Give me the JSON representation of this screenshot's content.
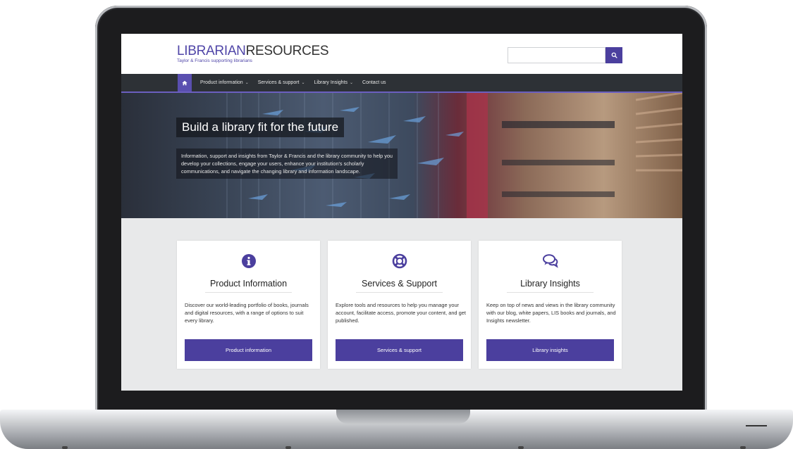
{
  "logo": {
    "part1": "LIBRARIAN",
    "part2": "RESOURCES",
    "tagline": "Taylor & Francis supporting librarians"
  },
  "search": {
    "placeholder": "",
    "icon": "search-icon"
  },
  "nav": {
    "home_icon": "home-icon",
    "items": [
      {
        "label": "Product information",
        "has_dropdown": true
      },
      {
        "label": "Services & support",
        "has_dropdown": true
      },
      {
        "label": "Library Insights",
        "has_dropdown": true
      },
      {
        "label": "Contact us",
        "has_dropdown": false
      }
    ]
  },
  "hero": {
    "title": "Build a library fit for the future",
    "text": "Information, support and insights from Taylor & Francis and the library community to help you develop your collections, engage your users, enhance your institution's scholarly communications, and navigate the changing library and information landscape."
  },
  "cards": [
    {
      "icon": "info-circle-icon",
      "title": "Product Information",
      "text": "Discover our world-leading portfolio of books, journals and digital resources, with a range of options to suit every library.",
      "button": "Product information"
    },
    {
      "icon": "life-ring-icon",
      "title": "Services & Support",
      "text": "Explore tools and resources to help you manage your account, facilitate access, promote your content, and get published.",
      "button": "Services & support"
    },
    {
      "icon": "chat-bubbles-icon",
      "title": "Library Insights",
      "text": "Keep on top of news and views in the library community with our blog, white papers, LIS books and journals, and Insights newsletter.",
      "button": "Library insights"
    }
  ],
  "colors": {
    "brand": "#4b3f9e",
    "nav_bg": "#2d3136",
    "page_bg": "#e8e9ea"
  }
}
